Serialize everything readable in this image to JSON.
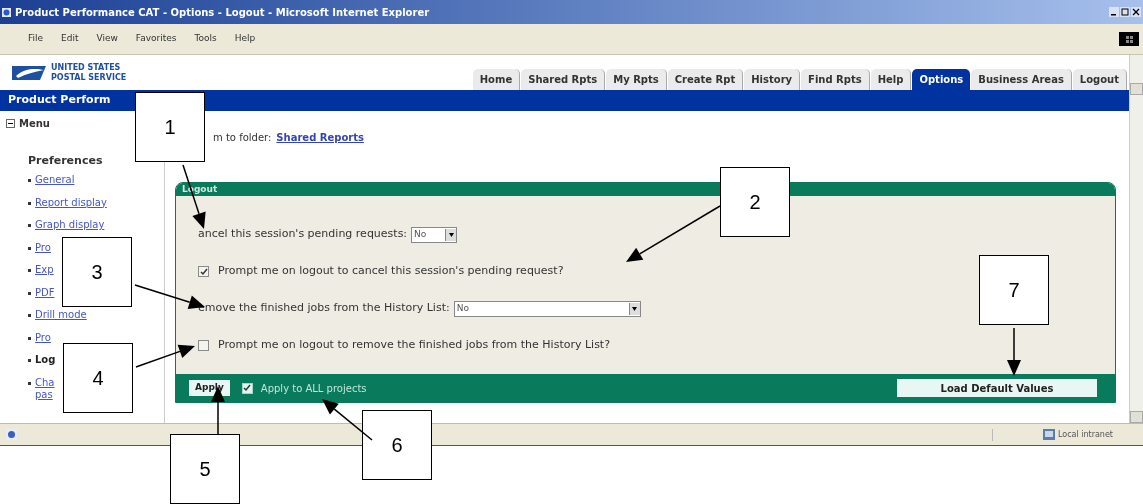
{
  "window": {
    "title": "Product Performance CAT - Options - Logout - Microsoft Internet Explorer"
  },
  "menu": [
    "File",
    "Edit",
    "View",
    "Favorites",
    "Tools",
    "Help"
  ],
  "logo": {
    "line1": "UNITED STATES",
    "line2": "POSTAL SERVICE"
  },
  "tabs": [
    {
      "label": "Home",
      "selected": false
    },
    {
      "label": "Shared Rpts",
      "selected": false
    },
    {
      "label": "My Rpts",
      "selected": false
    },
    {
      "label": "Create Rpt",
      "selected": false
    },
    {
      "label": "History",
      "selected": false
    },
    {
      "label": "Find Rpts",
      "selected": false
    },
    {
      "label": "Help",
      "selected": false
    },
    {
      "label": "Options",
      "selected": true
    },
    {
      "label": "Business Areas",
      "selected": false
    },
    {
      "label": "Logout",
      "selected": false
    }
  ],
  "banner": "Product Perform",
  "sidebar": {
    "title": "Menu",
    "expanded": true,
    "section": "Preferences",
    "items": [
      {
        "label": "General",
        "selected": false
      },
      {
        "label": "Report display",
        "selected": false
      },
      {
        "label": "Graph display",
        "selected": false
      },
      {
        "label": "Pro",
        "selected": false
      },
      {
        "label": "Exp",
        "selected": false
      },
      {
        "label": "PDF",
        "selected": false
      },
      {
        "label": "Drill mode",
        "selected": false
      },
      {
        "label": "Pro",
        "selected": false
      },
      {
        "label": "Log",
        "selected": true
      },
      {
        "label": "Cha\npas",
        "selected": false
      }
    ]
  },
  "return": {
    "label": "m to folder:",
    "link": "Shared Reports"
  },
  "panel": {
    "title": "Logout",
    "rows": [
      {
        "kind": "select",
        "label": "ancel this session's pending requests:",
        "value": "No",
        "wide": false
      },
      {
        "kind": "checkbox",
        "label": "Prompt me on logout to cancel this session's pending request?",
        "checked": true
      },
      {
        "kind": "select",
        "label": "emove the finished jobs from the History List:",
        "value": "No",
        "wide": true
      },
      {
        "kind": "checkbox",
        "label": "Prompt me on logout to remove the finished jobs from the History List?",
        "checked": false
      }
    ],
    "apply": "Apply",
    "all": {
      "label": "Apply to ALL projects",
      "checked": true
    },
    "defaults": "Load Default Values"
  },
  "status": {
    "zone": "Local intranet"
  },
  "callouts": [
    {
      "label": "1"
    },
    {
      "label": "2"
    },
    {
      "label": "3"
    },
    {
      "label": "4"
    },
    {
      "label": "5"
    },
    {
      "label": "6"
    },
    {
      "label": "7"
    }
  ]
}
